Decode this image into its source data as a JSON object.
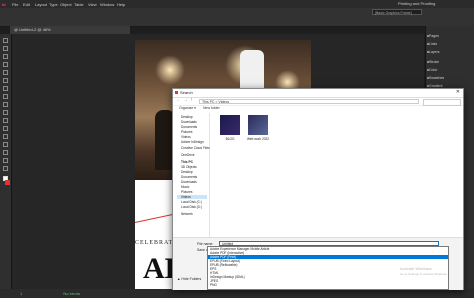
{
  "app": {
    "logo": "Id",
    "menus": [
      "File",
      "Edit",
      "Layout",
      "Type",
      "Object",
      "Table",
      "View",
      "Window",
      "Help"
    ],
    "workspace": "Printing and Proofing",
    "search_placeholder": "Adobe Stock",
    "control_field": "[Basic Graphics Frame]",
    "doc_tab": "@ Untitled-2 @ 46%",
    "status": {
      "page": "1",
      "errors": "No errors"
    }
  },
  "right_panel": {
    "items": [
      "Pages",
      "Links",
      "Layers",
      "Stroke",
      "Color",
      "Swatches",
      "Gradient",
      "CC Libraries",
      "Text Wrap",
      "Object Styles"
    ]
  },
  "page_content": {
    "title": "CELEBRATE",
    "big_text": "AL"
  },
  "dialog": {
    "title": "Search",
    "address": "This PC > Videos",
    "toolbar": {
      "organize": "Organize ▾",
      "new_folder": "New folder"
    },
    "nav": [
      {
        "label": "Desktop"
      },
      {
        "label": "Downloads"
      },
      {
        "label": "Documents"
      },
      {
        "label": "Pictures"
      },
      {
        "label": "Videos"
      },
      {
        "label": "Adobe InDesign"
      },
      {
        "label": "Creative Cloud Files"
      },
      {
        "label": "OneDrive"
      },
      {
        "label": "This PC",
        "selected": true
      },
      {
        "label": "3D Objects"
      },
      {
        "label": "Desktop"
      },
      {
        "label": "Documents"
      },
      {
        "label": "Downloads"
      },
      {
        "label": "Music"
      },
      {
        "label": "Pictures"
      },
      {
        "label": "Videos",
        "selected": true
      },
      {
        "label": "Local Disk (C:)"
      },
      {
        "label": "Local Disk (D:)"
      },
      {
        "label": "Network"
      }
    ],
    "files": [
      {
        "label": "BLOG",
        "color": "#1a1a4a"
      },
      {
        "label": "Web work 2022",
        "color": "#2a2a5a"
      }
    ],
    "form": {
      "file_name_label": "File name:",
      "file_name_value": "Untitled",
      "save_type_label": "Save as type:",
      "save_type_value": "JPEG",
      "hide_folders": "▲ Hide Folders"
    },
    "type_options": [
      "Adobe Experience Manager Mobile Article",
      "Adobe PDF (Interactive)",
      "Adobe PDF (Print)",
      "EPUB (Fixed Layout)",
      "EPUB (Reflowable)",
      "EPS",
      "HTML",
      "InDesign Markup (IDML)",
      "JPEG",
      "PNG",
      "XML"
    ],
    "type_selected_index": 2
  },
  "watermark": {
    "line1": "Activate Windows",
    "line2": "Go to Settings to activate Windows."
  }
}
